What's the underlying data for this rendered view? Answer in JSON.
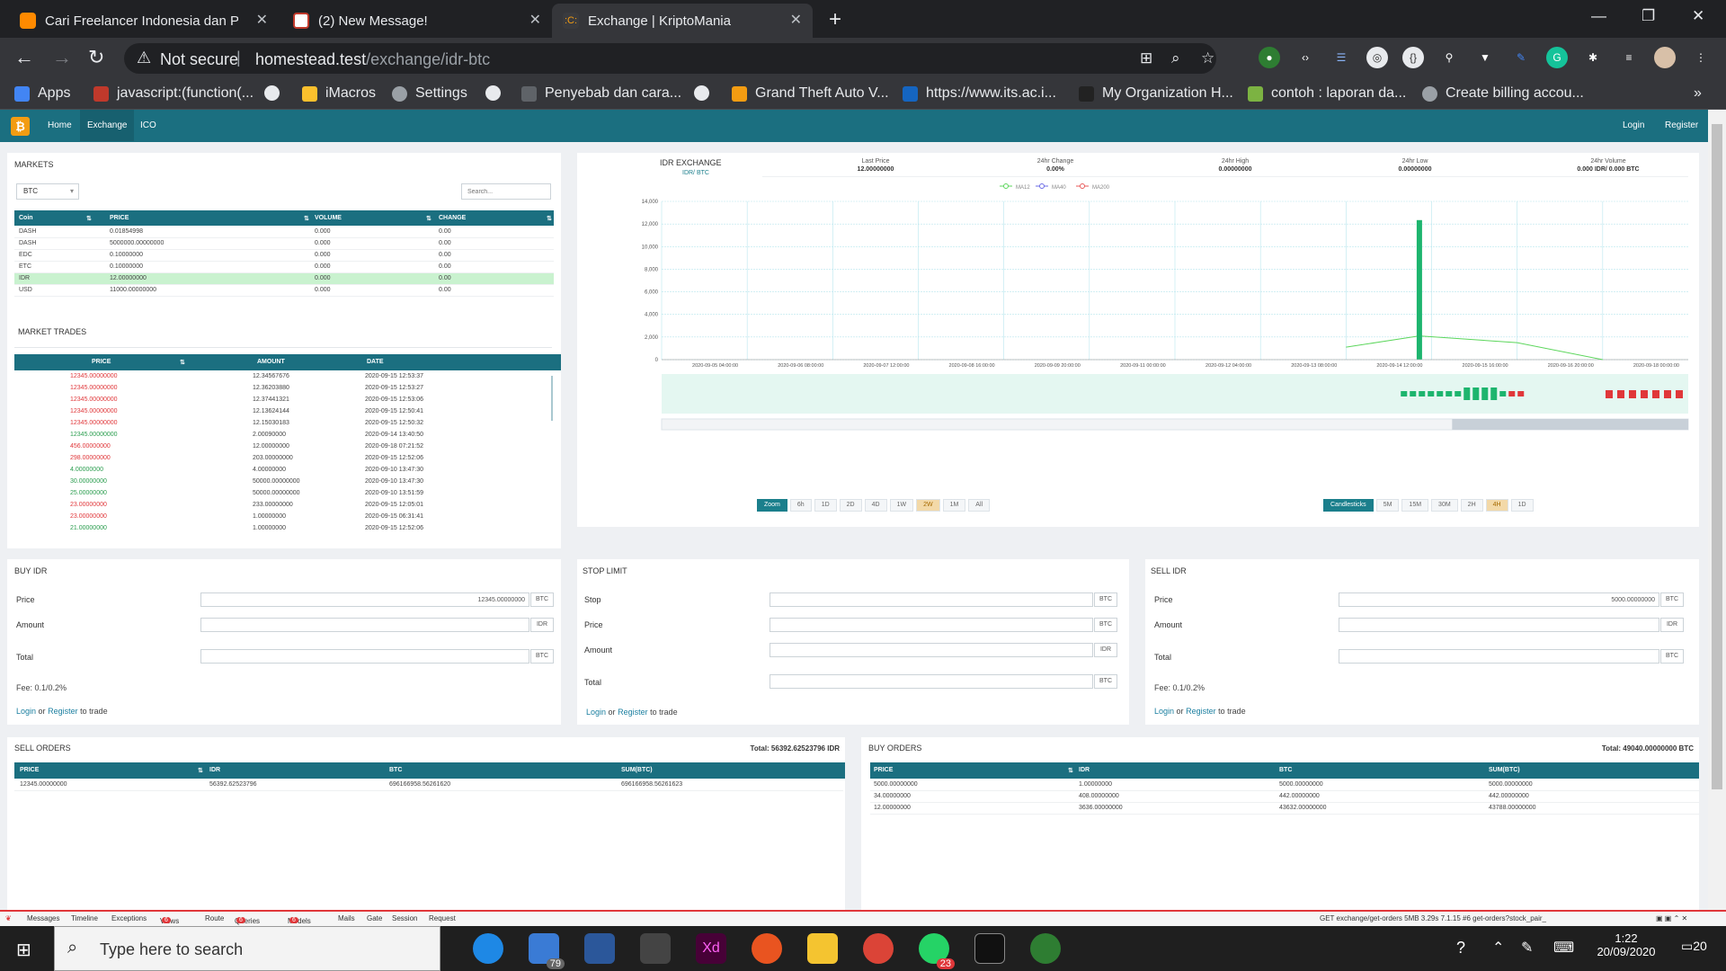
{
  "browser": {
    "tabs": [
      {
        "title": "Cari Freelancer Indonesia dan Pek",
        "color": "#ff8a00"
      },
      {
        "title": "(2) New Message!",
        "color": "#c0392b"
      },
      {
        "title": "Exchange | KriptoMania",
        "color": "#f39c12"
      }
    ],
    "not_secure": "Not secure",
    "url_sep": "|",
    "url_host": "homestead.test",
    "url_path": "/exchange/idr-btc",
    "bookmarks": [
      "Apps",
      "javascript:(function(...",
      "",
      "iMacros",
      "Settings",
      "",
      "Penyebab dan cara...",
      "",
      "Grand Theft Auto V...",
      "https://www.its.ac.i...",
      "My Organization H...",
      "contoh : laporan da...",
      "Create billing accou..."
    ]
  },
  "nav": {
    "home": "Home",
    "exchange": "Exchange",
    "ico": "ICO",
    "login": "Login",
    "register": "Register"
  },
  "markets": {
    "title": "MARKETS",
    "select": "BTC",
    "search_placeholder": "Search...",
    "headers": [
      "Coin",
      "PRICE",
      "VOLUME",
      "CHANGE"
    ],
    "rows": [
      {
        "coin": "DASH",
        "price": "0.01854998",
        "volume": "0.000",
        "change": "0.00"
      },
      {
        "coin": "DASH",
        "price": "5000000.00000000",
        "volume": "0.000",
        "change": "0.00"
      },
      {
        "coin": "EDC",
        "price": "0.10000000",
        "volume": "0.000",
        "change": "0.00"
      },
      {
        "coin": "ETC",
        "price": "0.10000000",
        "volume": "0.000",
        "change": "0.00"
      },
      {
        "coin": "IDR",
        "price": "12.00000000",
        "volume": "0.000",
        "change": "0.00"
      },
      {
        "coin": "USD",
        "price": "11000.00000000",
        "volume": "0.000",
        "change": "0.00"
      }
    ]
  },
  "market_trades": {
    "title": "MARKET TRADES",
    "headers": [
      "PRICE",
      "AMOUNT",
      "DATE"
    ],
    "rows": [
      {
        "price": "12345.00000000",
        "amount": "12.34567676",
        "date": "2020-09-15 12:53:37",
        "side": "sell"
      },
      {
        "price": "12345.00000000",
        "amount": "12.36203880",
        "date": "2020-09-15 12:53:27",
        "side": "sell"
      },
      {
        "price": "12345.00000000",
        "amount": "12.37441321",
        "date": "2020-09-15 12:53:06",
        "side": "sell"
      },
      {
        "price": "12345.00000000",
        "amount": "12.13624144",
        "date": "2020-09-15 12:50:41",
        "side": "sell"
      },
      {
        "price": "12345.00000000",
        "amount": "12.15030183",
        "date": "2020-09-15 12:50:32",
        "side": "sell"
      },
      {
        "price": "12345.00000000",
        "amount": "2.00090000",
        "date": "2020-09-14 13:40:50",
        "side": "buy"
      },
      {
        "price": "456.00000000",
        "amount": "12.00000000",
        "date": "2020-09-18 07:21:52",
        "side": "sell"
      },
      {
        "price": "298.00000000",
        "amount": "203.00000000",
        "date": "2020-09-15 12:52:06",
        "side": "sell"
      },
      {
        "price": "4.00000000",
        "amount": "4.00000000",
        "date": "2020-09-10 13:47:30",
        "side": "buy"
      },
      {
        "price": "30.00000000",
        "amount": "50000.00000000",
        "date": "2020-09-10 13:47:30",
        "side": "buy"
      },
      {
        "price": "25.00000000",
        "amount": "50000.00000000",
        "date": "2020-09-10 13:51:59",
        "side": "buy"
      },
      {
        "price": "23.00000000",
        "amount": "233.00000000",
        "date": "2020-09-15 12:05:01",
        "side": "sell"
      },
      {
        "price": "23.00000000",
        "amount": "1.00000000",
        "date": "2020-09-15 06:31:41",
        "side": "sell"
      },
      {
        "price": "21.00000000",
        "amount": "1.00000000",
        "date": "2020-09-15 12:52:06",
        "side": "buy"
      }
    ]
  },
  "exchange": {
    "title": "IDR EXCHANGE",
    "pair": "IDR/ BTC",
    "stats": [
      {
        "label": "Last Price",
        "value": "12.00000000"
      },
      {
        "label": "24hr Change",
        "value": "0.00%"
      },
      {
        "label": "24hr High",
        "value": "0.00000000"
      },
      {
        "label": "24hr Low",
        "value": "0.00000000"
      },
      {
        "label": "24hr Volume",
        "value": "0.000 IDR/ 0.000 BTC"
      }
    ],
    "legend": [
      "MA12",
      "MA40",
      "MA200"
    ],
    "zoom_buttons": [
      "Zoom",
      "6h",
      "1D",
      "2D",
      "4D",
      "1W",
      "2W",
      "1M",
      "All"
    ],
    "zoom_selected": "2W",
    "candle_buttons": [
      "Candlesticks",
      "5M",
      "15M",
      "30M",
      "2H",
      "4H",
      "1D"
    ],
    "candle_selected": "4H"
  },
  "chart_data": {
    "type": "bar",
    "ylim": [
      0,
      14000
    ],
    "y_ticks": [
      "0",
      "2,000",
      "4,000",
      "6,000",
      "8,000",
      "10,000",
      "12,000",
      "14,000"
    ],
    "x_ticks": [
      "2020-09-05 04:00:00",
      "2020-09-06 08:00:00",
      "2020-09-07 12:00:00",
      "2020-09-08 16:00:00",
      "2020-09-09 20:00:00",
      "2020-09-11 00:00:00",
      "2020-09-12 04:00:00",
      "2020-09-13 08:00:00",
      "2020-09-14 12:00:00",
      "2020-09-15 16:00:00",
      "2020-09-16 20:00:00",
      "2020-09-18 00:00:00"
    ],
    "series": [
      {
        "name": "candle",
        "values": [
          {
            "x": "2020-09-15 12:00:00",
            "open": 23,
            "high": 12345,
            "low": 23,
            "close": 12345
          }
        ]
      },
      {
        "name": "MA12",
        "values": [
          {
            "x": "2020-09-14 12:00:00",
            "y": 1100
          },
          {
            "x": "2020-09-15 12:00:00",
            "y": 2100
          },
          {
            "x": "2020-09-16 20:00:00",
            "y": 1500
          },
          {
            "x": "2020-09-18 00:00:00",
            "y": 0
          }
        ]
      }
    ],
    "colors": {
      "up": "#1db56e",
      "down": "#e0373a",
      "ma12": "#5cd65c",
      "ma40": "#6b6be6",
      "ma200": "#e85a5a"
    }
  },
  "buy": {
    "title": "BUY IDR",
    "price_label": "Price",
    "price_value": "12345.00000000",
    "price_cur": "BTC",
    "amount_label": "Amount",
    "amount_cur": "IDR",
    "total_label": "Total",
    "total_cur": "BTC",
    "fee": "Fee: 0.1/0.2%",
    "login": "Login",
    "or": "or",
    "register": "Register",
    "to_trade": "to trade"
  },
  "stop": {
    "title": "STOP LIMIT",
    "stop_label": "Stop",
    "stop_cur": "BTC",
    "price_label": "Price",
    "price_cur": "BTC",
    "amount_label": "Amount",
    "amount_cur": "IDR",
    "total_label": "Total",
    "total_cur": "BTC",
    "login": "Login",
    "or": "or",
    "register": "Register",
    "to_trade": "to trade"
  },
  "sell": {
    "title": "SELL IDR",
    "price_label": "Price",
    "price_value": "5000.00000000",
    "price_cur": "BTC",
    "amount_label": "Amount",
    "amount_cur": "IDR",
    "total_label": "Total",
    "total_cur": "BTC",
    "fee": "Fee: 0.1/0.2%",
    "login": "Login",
    "or": "or",
    "register": "Register",
    "to_trade": "to trade"
  },
  "sell_orders": {
    "title": "SELL ORDERS",
    "total": "Total: 56392.62523796 IDR",
    "headers": [
      "PRICE",
      "IDR",
      "BTC",
      "SUM(BTC)"
    ],
    "rows": [
      {
        "price": "12345.00000000",
        "idr": "56392.62523796",
        "btc": "696166958.56261620",
        "sum": "696166958.56261623"
      }
    ]
  },
  "buy_orders": {
    "title": "BUY ORDERS",
    "total": "Total: 49040.00000000 BTC",
    "headers": [
      "PRICE",
      "IDR",
      "BTC",
      "SUM(BTC)"
    ],
    "rows": [
      {
        "price": "5000.00000000",
        "idr": "1.00000000",
        "btc": "5000.00000000",
        "sum": "5000.00000000"
      },
      {
        "price": "34.00000000",
        "idr": "408.00000000",
        "btc": "442.00000000",
        "sum": "442.00000000"
      },
      {
        "price": "12.00000000",
        "idr": "3636.00000000",
        "btc": "43632.00000000",
        "sum": "43788.00000000"
      }
    ]
  },
  "debugbar": {
    "items": [
      "Messages",
      "Timeline",
      "Exceptions",
      "Views",
      "Route",
      "Queries",
      "Models",
      "Mails",
      "Gate",
      "Session",
      "Request"
    ],
    "badges": {
      "views": "6",
      "queries": "6",
      "models": "6"
    },
    "right": "GET exchange/get-orders   5MB   3.29s   7.1.15   #6 get-orders?stock_pair_"
  },
  "taskbar": {
    "search": "Type here to search",
    "time": "1:22",
    "date": "20/09/2020",
    "mail_badge": "79",
    "wa_badge": "23",
    "notif": "20"
  }
}
